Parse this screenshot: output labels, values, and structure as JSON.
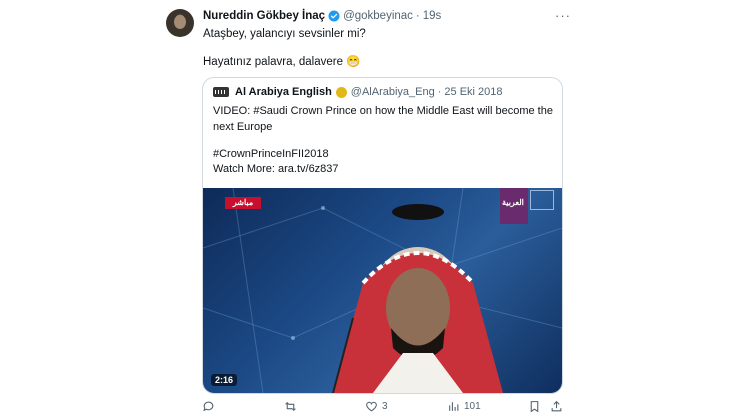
{
  "tweet": {
    "author_name": "Nureddin Gökbey İnaç",
    "handle": "@gokbeyinac",
    "time": "19s",
    "line1": "Ataşbey, yalancıyı sevsinler mi?",
    "line2": "Hayatınız palavra, dalavere 😁"
  },
  "quote": {
    "author_name": "Al Arabiya English",
    "handle": "@AlArabiya_Eng",
    "date": "25 Eki 2018",
    "line1": "VIDEO: #Saudi Crown Prince on how the Middle East will become the",
    "line2": "next Europe",
    "line3": "#CrownPrinceInFII2018",
    "line4": "Watch More: ara.tv/6z837",
    "video": {
      "live_badge": "مباشر",
      "channel_logo": "العربية",
      "duration": "2:16"
    }
  },
  "actions": {
    "reply_count": "",
    "retweet_count": "",
    "like_count": "3",
    "views_count": "101"
  },
  "colors": {
    "verified": "#1d9bf0",
    "muted": "#536471",
    "border": "#cfd9de"
  }
}
